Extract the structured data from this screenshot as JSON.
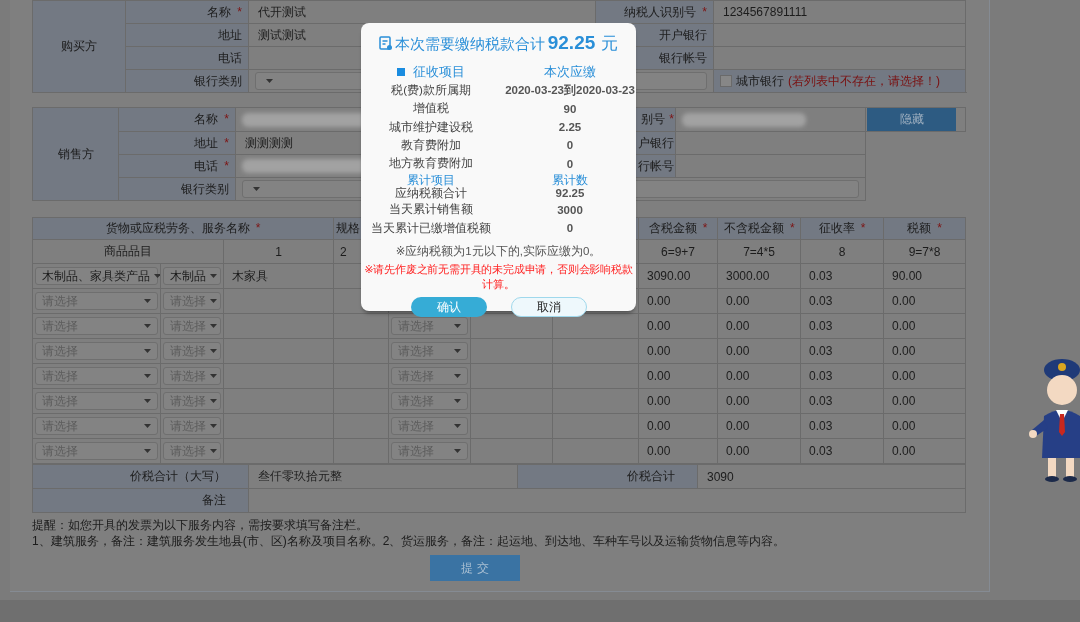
{
  "required_mark": "*",
  "buyer": {
    "group": "购买方",
    "rows": [
      {
        "kind": "pair",
        "label": "名称",
        "required": true,
        "value": "代开测试",
        "label2": "纳税人识别号",
        "required2": true,
        "value2": "1234567891111"
      },
      {
        "kind": "pair",
        "label": "地址",
        "required": false,
        "value": "测试测试",
        "label2": "开户银行",
        "required2": false
      },
      {
        "kind": "pair",
        "label": "电话",
        "required": false,
        "label2": "银行帐号",
        "required2": false
      },
      {
        "kind": "bank",
        "label": "银行类别",
        "required": false,
        "checkbox": {
          "label": "城市银行",
          "hint": "(若列表中不存在，请选择！)",
          "checked": false
        }
      }
    ]
  },
  "seller": {
    "group": "销售方",
    "hide_button": "隐藏",
    "rows": [
      {
        "kind": "pair",
        "label": "名称",
        "required": true,
        "blurred": true,
        "label2": "别号",
        "required2": true,
        "blurred2": true
      },
      {
        "kind": "pair",
        "label": "地址",
        "required": true,
        "value": "测测测测",
        "blurred": false,
        "label2": "户银行",
        "required2": false,
        "blurred2": false
      },
      {
        "kind": "pair",
        "label": "电话",
        "required": true,
        "blurred": true,
        "label2": "行帐号",
        "required2": false,
        "blurred2": false
      },
      {
        "kind": "bank",
        "label": "银行类别",
        "required": false
      }
    ]
  },
  "goods": {
    "columns": [
      {
        "kind": "header",
        "title": "货物或应税劳务、服务名称",
        "required": true,
        "colspan": 3
      },
      {
        "kind": "header",
        "title": "规格",
        "required": false
      },
      {
        "kind": "blank"
      },
      {
        "kind": "blank"
      },
      {
        "kind": "blank"
      },
      {
        "kind": "header",
        "title": "含税金额",
        "required": true
      },
      {
        "kind": "header",
        "title": "不含税金额",
        "required": true
      },
      {
        "kind": "header",
        "title": "征收率",
        "required": true
      },
      {
        "kind": "header",
        "title": "税额",
        "required": true
      }
    ],
    "numbering": [
      {
        "kind": "text",
        "text": "商品品目",
        "colspan": 2
      },
      {
        "kind": "text",
        "text": "1"
      },
      {
        "kind": "text",
        "text": "2"
      },
      {
        "kind": "blank"
      },
      {
        "kind": "blank"
      },
      {
        "kind": "blank"
      },
      {
        "kind": "text",
        "text": "6=9+7"
      },
      {
        "kind": "text",
        "text": "7=4*5"
      },
      {
        "kind": "text",
        "text": "8"
      },
      {
        "kind": "text",
        "text": "9=7*8"
      }
    ],
    "rows": [
      [
        {
          "kind": "select",
          "value": "木制品、家具类产品"
        },
        {
          "kind": "select",
          "value": "木制品"
        },
        {
          "kind": "input",
          "value": "木家具"
        },
        {
          "kind": "blank"
        },
        {
          "kind": "blank"
        },
        {
          "kind": "blank"
        },
        {
          "kind": "blank"
        },
        {
          "kind": "text",
          "value": "3090.00"
        },
        {
          "kind": "text",
          "value": "3000.00"
        },
        {
          "kind": "text",
          "value": "0.03"
        },
        {
          "kind": "text",
          "value": "90.00"
        }
      ],
      [
        {
          "kind": "select",
          "placeholder": "请选择"
        },
        {
          "kind": "select",
          "placeholder": "请选择"
        },
        {
          "kind": "blank"
        },
        {
          "kind": "blank"
        },
        {
          "kind": "blank"
        },
        {
          "kind": "blank"
        },
        {
          "kind": "blank"
        },
        {
          "kind": "text",
          "value": "0.00"
        },
        {
          "kind": "text",
          "value": "0.00"
        },
        {
          "kind": "text",
          "value": "0.03"
        },
        {
          "kind": "text",
          "value": "0.00"
        }
      ],
      [
        {
          "kind": "select",
          "placeholder": "请选择"
        },
        {
          "kind": "select",
          "placeholder": "请选择"
        },
        {
          "kind": "blank"
        },
        {
          "kind": "blank"
        },
        {
          "kind": "select",
          "placeholder": "请选择"
        },
        {
          "kind": "blank"
        },
        {
          "kind": "blank"
        },
        {
          "kind": "text",
          "value": "0.00"
        },
        {
          "kind": "text",
          "value": "0.00"
        },
        {
          "kind": "text",
          "value": "0.03"
        },
        {
          "kind": "text",
          "value": "0.00"
        }
      ],
      [
        {
          "kind": "select",
          "placeholder": "请选择"
        },
        {
          "kind": "select",
          "placeholder": "请选择"
        },
        {
          "kind": "blank"
        },
        {
          "kind": "blank"
        },
        {
          "kind": "select",
          "placeholder": "请选择"
        },
        {
          "kind": "blank"
        },
        {
          "kind": "blank"
        },
        {
          "kind": "text",
          "value": "0.00"
        },
        {
          "kind": "text",
          "value": "0.00"
        },
        {
          "kind": "text",
          "value": "0.03"
        },
        {
          "kind": "text",
          "value": "0.00"
        }
      ],
      [
        {
          "kind": "select",
          "placeholder": "请选择"
        },
        {
          "kind": "select",
          "placeholder": "请选择"
        },
        {
          "kind": "blank"
        },
        {
          "kind": "blank"
        },
        {
          "kind": "select",
          "placeholder": "请选择"
        },
        {
          "kind": "blank"
        },
        {
          "kind": "blank"
        },
        {
          "kind": "text",
          "value": "0.00"
        },
        {
          "kind": "text",
          "value": "0.00"
        },
        {
          "kind": "text",
          "value": "0.03"
        },
        {
          "kind": "text",
          "value": "0.00"
        }
      ],
      [
        {
          "kind": "select",
          "placeholder": "请选择"
        },
        {
          "kind": "select",
          "placeholder": "请选择"
        },
        {
          "kind": "blank"
        },
        {
          "kind": "blank"
        },
        {
          "kind": "select",
          "placeholder": "请选择"
        },
        {
          "kind": "blank"
        },
        {
          "kind": "blank"
        },
        {
          "kind": "text",
          "value": "0.00"
        },
        {
          "kind": "text",
          "value": "0.00"
        },
        {
          "kind": "text",
          "value": "0.03"
        },
        {
          "kind": "text",
          "value": "0.00"
        }
      ],
      [
        {
          "kind": "select",
          "placeholder": "请选择"
        },
        {
          "kind": "select",
          "placeholder": "请选择"
        },
        {
          "kind": "blank"
        },
        {
          "kind": "blank"
        },
        {
          "kind": "select",
          "placeholder": "请选择"
        },
        {
          "kind": "blank"
        },
        {
          "kind": "blank"
        },
        {
          "kind": "text",
          "value": "0.00"
        },
        {
          "kind": "text",
          "value": "0.00"
        },
        {
          "kind": "text",
          "value": "0.03"
        },
        {
          "kind": "text",
          "value": "0.00"
        }
      ],
      [
        {
          "kind": "select",
          "placeholder": "请选择"
        },
        {
          "kind": "select",
          "placeholder": "请选择"
        },
        {
          "kind": "blank"
        },
        {
          "kind": "blank"
        },
        {
          "kind": "select",
          "placeholder": "请选择"
        },
        {
          "kind": "blank"
        },
        {
          "kind": "blank"
        },
        {
          "kind": "text",
          "value": "0.00"
        },
        {
          "kind": "text",
          "value": "0.00"
        },
        {
          "kind": "text",
          "value": "0.03"
        },
        {
          "kind": "text",
          "value": "0.00"
        }
      ]
    ]
  },
  "totals": {
    "words_label": "价税合计（大写）",
    "words": "叁仟零玖拾元整",
    "total_label": "价税合计",
    "total": "3090",
    "remark_label": "备注"
  },
  "notes": [
    "提醒：如您开具的发票为以下服务内容，需按要求填写备注栏。",
    "1、建筑服务，备注：建筑服务发生地县(市、区)名称及项目名称。2、货运服务，备注：起运地、到达地、车种车号以及运输货物信息等内容。"
  ],
  "submit": "提 交",
  "dialog": {
    "title": "本次需要缴纳税款合计",
    "amount": "92.25",
    "unit": "元",
    "head": [
      "征收项目",
      "本次应缴"
    ],
    "rows": [
      {
        "item": "税(费)款所属期",
        "amount": "2020-03-23到2020-03-23"
      },
      {
        "item": "增值税",
        "amount": "90"
      },
      {
        "item": "城市维护建设税",
        "amount": "2.25"
      },
      {
        "item": "教育费附加",
        "amount": "0"
      },
      {
        "item": "地方教育费附加",
        "amount": "0"
      },
      {
        "item": "应纳税额合计",
        "amount": "92.25",
        "overlay_item": "累计项目",
        "overlay_amount": "累计数"
      },
      {
        "item": "当天累计销售额",
        "amount": "3000"
      },
      {
        "item": "当天累计已缴增值税额",
        "amount": "0"
      }
    ],
    "note": "※应纳税额为1元以下的,实际应缴为0。",
    "warning": "※请先作废之前无需开具的未完成申请，否则会影响税款计算。",
    "buttons": [
      "确认",
      "取消"
    ]
  }
}
